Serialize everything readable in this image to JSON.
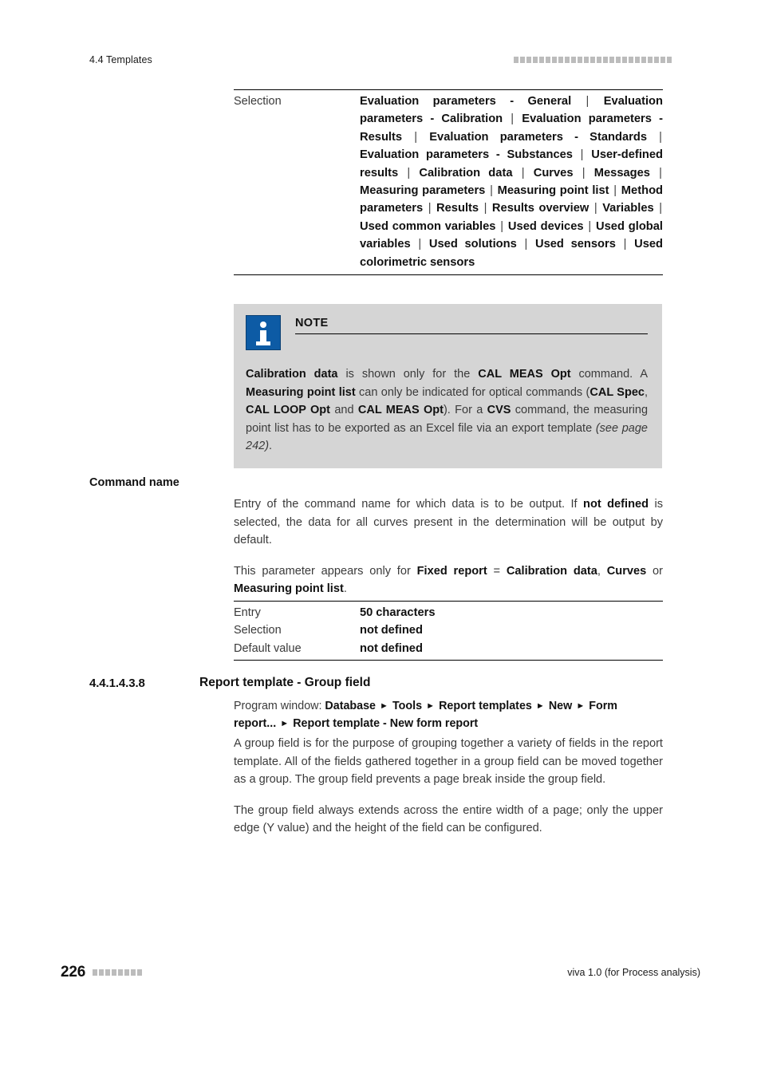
{
  "header": {
    "running_title": "4.4 Templates",
    "marker_count": 25,
    "marker_color": "#bcbcbc"
  },
  "selection_table": {
    "label": "Selection",
    "options": [
      "Evaluation parameters - General",
      "Evaluation parameters - Calibration",
      "Evaluation parameters - Results",
      "Evaluation parameters - Standards",
      "Evaluation parameters - Substances",
      "User-defined results",
      "Calibration data",
      "Curves",
      "Messages",
      "Measuring parameters",
      "Measuring point list",
      "Method parameters",
      "Results",
      "Results overview",
      "Variables",
      "Used common variables",
      "Used devices",
      "Used global variables",
      "Used solutions",
      "Used sensors",
      "Used colorimetric sensors"
    ],
    "separator": "|"
  },
  "note": {
    "icon": "info-icon",
    "icon_color": "#0d5ba5",
    "background": "#d5d5d5",
    "title": "NOTE",
    "text_segments": [
      {
        "text": "Calibration data",
        "bold": true
      },
      {
        "text": " is shown only for the ",
        "bold": false
      },
      {
        "text": "CAL MEAS Opt",
        "bold": true
      },
      {
        "text": " command. A ",
        "bold": false
      },
      {
        "text": "Measuring point list",
        "bold": true
      },
      {
        "text": " can only be indicated for optical commands (",
        "bold": false
      },
      {
        "text": "CAL Spec",
        "bold": true
      },
      {
        "text": ", ",
        "bold": false
      },
      {
        "text": "CAL LOOP Opt",
        "bold": true
      },
      {
        "text": " and ",
        "bold": false
      },
      {
        "text": "CAL MEAS Opt",
        "bold": true
      },
      {
        "text": "). For a ",
        "bold": false
      },
      {
        "text": "CVS",
        "bold": true
      },
      {
        "text": " command, the measuring point list has to be exported as an Excel file via an export template ",
        "bold": false
      },
      {
        "text": "(see page 242)",
        "bold": false,
        "italic": true
      },
      {
        "text": ".",
        "bold": false
      }
    ]
  },
  "command_name": {
    "marginal_label": "Command name",
    "paragraph1_segments": [
      {
        "text": "Entry of the command name for which data is to be output. If ",
        "bold": false
      },
      {
        "text": "not defined",
        "bold": true
      },
      {
        "text": " is selected, the data for all curves present in the determination will be output by default.",
        "bold": false
      }
    ],
    "paragraph2_segments": [
      {
        "text": "This parameter appears only for ",
        "bold": false
      },
      {
        "text": "Fixed report",
        "bold": true
      },
      {
        "text": " = ",
        "bold": false
      },
      {
        "text": "Calibration data",
        "bold": true
      },
      {
        "text": ", ",
        "bold": false
      },
      {
        "text": "Curves",
        "bold": true
      },
      {
        "text": " or ",
        "bold": false
      },
      {
        "text": "Measuring point list",
        "bold": true
      },
      {
        "text": ".",
        "bold": false
      }
    ],
    "table": [
      {
        "label": "Entry",
        "value": "50 characters"
      },
      {
        "label": "Selection",
        "value": "not defined"
      },
      {
        "label": "Default value",
        "value": "not defined"
      }
    ]
  },
  "section": {
    "number": "4.4.1.4.3.8",
    "title": "Report template - Group field",
    "program_window_prefix": "Program window:",
    "breadcrumb": [
      "Database",
      "Tools",
      "Report templates",
      "New",
      "Form report...",
      "Report template - New form report"
    ],
    "breadcrumb_arrow": "►",
    "paragraph1": "A group field is for the purpose of grouping together a variety of fields in the report template. All of the fields gathered together in a group field can be moved together as a group. The group field prevents a page break inside the group field.",
    "paragraph2": "The group field always extends across the entire width of a page; only the upper edge (Y value) and the height of the field can be configured."
  },
  "footer": {
    "page_number": "226",
    "marker_count": 8,
    "marker_color": "#bcbcbc",
    "product": "viva 1.0 (for Process analysis)"
  }
}
